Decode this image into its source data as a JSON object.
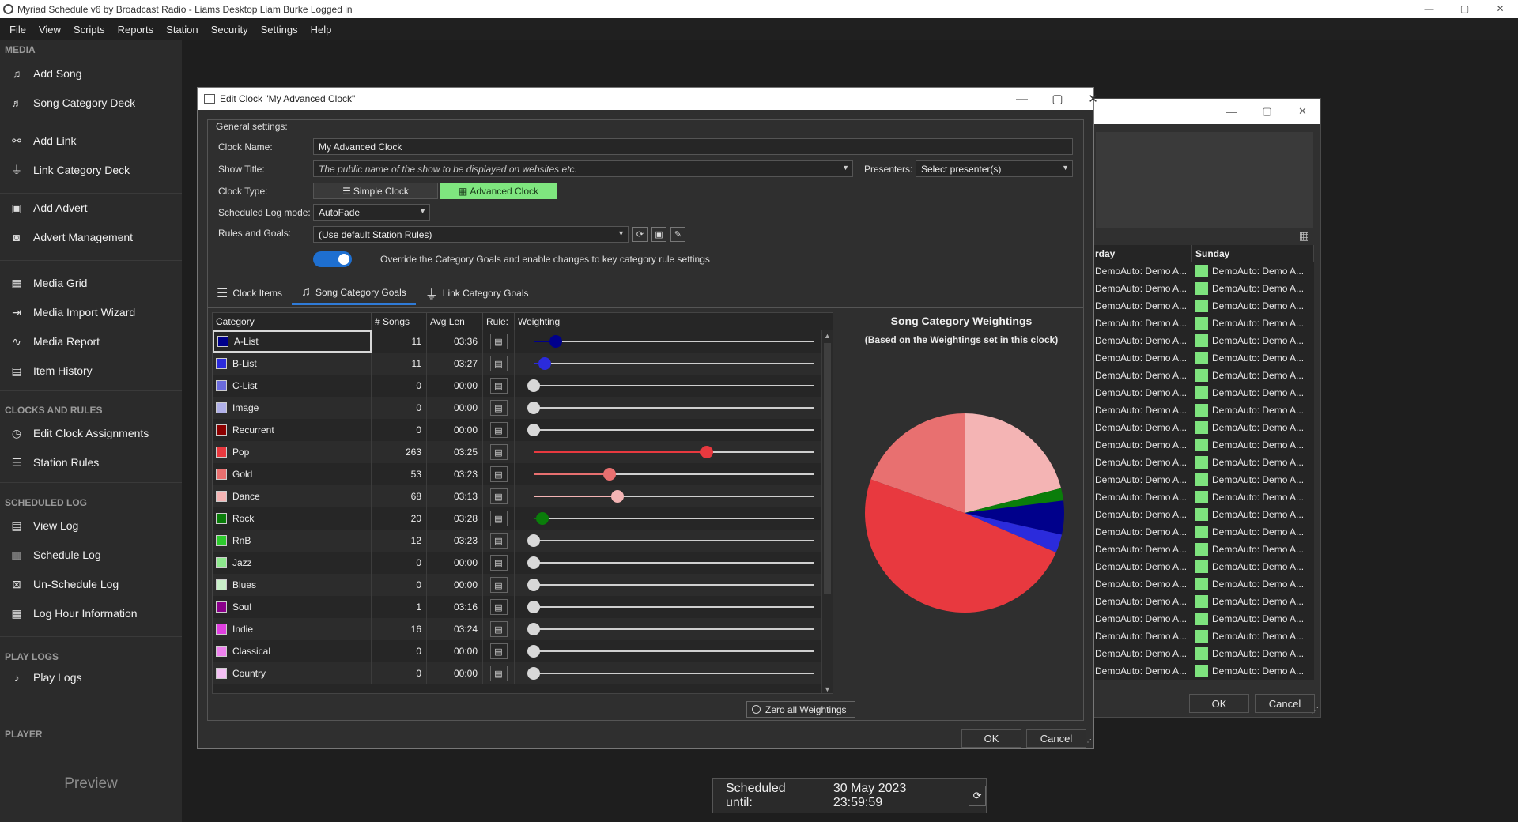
{
  "window": {
    "title": "Myriad Schedule v6 by Broadcast Radio - Liams Desktop Liam Burke Logged in",
    "min": "—",
    "max": "▢",
    "close": "✕"
  },
  "menu": [
    "File",
    "View",
    "Scripts",
    "Reports",
    "Station",
    "Security",
    "Settings",
    "Help"
  ],
  "sidebar": {
    "sections": [
      {
        "label": "MEDIA",
        "items": [
          {
            "label": "Add Song",
            "icon": "add-song-icon"
          },
          {
            "label": "Song Category Deck",
            "icon": "music-note-icon"
          },
          {
            "label": "Add Link",
            "icon": "add-link-icon"
          },
          {
            "label": "Link Category Deck",
            "icon": "antenna-icon"
          },
          {
            "label": "Add Advert",
            "icon": "add-advert-icon"
          },
          {
            "label": "Advert Management",
            "icon": "camera-icon"
          },
          {
            "label": "Media Grid",
            "icon": "grid-icon"
          },
          {
            "label": "Media Import Wizard",
            "icon": "import-icon"
          },
          {
            "label": "Media Report",
            "icon": "waveform-icon"
          },
          {
            "label": "Item History",
            "icon": "history-icon"
          }
        ]
      },
      {
        "label": "CLOCKS AND RULES",
        "items": [
          {
            "label": "Edit Clock Assignments",
            "icon": "clock-icon"
          },
          {
            "label": "Station Rules",
            "icon": "rules-icon"
          }
        ]
      },
      {
        "label": "SCHEDULED LOG",
        "items": [
          {
            "label": "View Log",
            "icon": "log-icon"
          },
          {
            "label": "Schedule Log",
            "icon": "schedule-icon"
          },
          {
            "label": "Un-Schedule Log",
            "icon": "unschedule-icon"
          },
          {
            "label": "Log Hour Information",
            "icon": "table-icon"
          }
        ]
      },
      {
        "label": "PLAY LOGS",
        "items": [
          {
            "label": "Play Logs",
            "icon": "play-logs-icon"
          }
        ]
      },
      {
        "label": "PLAYER",
        "items": []
      }
    ],
    "preview": "Preview"
  },
  "scheduled": {
    "label": "Scheduled until:",
    "value": "30 May 2023 23:59:59"
  },
  "bg_window": {
    "columns": [
      "rday",
      "Sunday"
    ],
    "row_text": "DemoAuto: Demo A...",
    "row_count": 24,
    "ok": "OK",
    "cancel": "Cancel"
  },
  "dialog": {
    "title": "Edit Clock \"My Advanced Clock\"",
    "group_label": "General settings:",
    "clock_name_label": "Clock Name:",
    "clock_name": "My Advanced Clock",
    "show_title_label": "Show Title:",
    "show_title_placeholder": "The public name of the show to be displayed on websites etc.",
    "presenters_label": "Presenters:",
    "presenters_value": "Select presenter(s)",
    "clock_type_label": "Clock Type:",
    "simple_clock": "Simple Clock",
    "advanced_clock": "Advanced Clock",
    "log_mode_label": "Scheduled Log mode:",
    "log_mode": "AutoFade",
    "rules_label": "Rules and Goals:",
    "rules_value": "(Use default Station Rules)",
    "override_text": "Override the Category Goals and enable changes to key category rule settings",
    "override_on": true,
    "tabs": [
      "Clock Items",
      "Song Category Goals",
      "Link Category Goals"
    ],
    "active_tab": "Song Category Goals",
    "columns": [
      "Category",
      "# Songs",
      "Avg Len",
      "Rule:",
      "Weighting"
    ],
    "rows": [
      {
        "name": "A-List",
        "songs": "11",
        "len": "03:36",
        "color": "#00008b",
        "weight": 0.08
      },
      {
        "name": "B-List",
        "songs": "11",
        "len": "03:27",
        "color": "#2b2bdc",
        "weight": 0.04
      },
      {
        "name": "C-List",
        "songs": "0",
        "len": "00:00",
        "color": "#6b6bdc",
        "weight": 0
      },
      {
        "name": "Image",
        "songs": "0",
        "len": "00:00",
        "color": "#b0b0e8",
        "weight": 0
      },
      {
        "name": "Recurrent",
        "songs": "0",
        "len": "00:00",
        "color": "#8b0000",
        "weight": 0
      },
      {
        "name": "Pop",
        "songs": "263",
        "len": "03:25",
        "color": "#e8393f",
        "weight": 0.62
      },
      {
        "name": "Gold",
        "songs": "53",
        "len": "03:23",
        "color": "#e87070",
        "weight": 0.27
      },
      {
        "name": "Dance",
        "songs": "68",
        "len": "03:13",
        "color": "#f4b4b4",
        "weight": 0.3
      },
      {
        "name": "Rock",
        "songs": "20",
        "len": "03:28",
        "color": "#0a7d0a",
        "weight": 0.03
      },
      {
        "name": "RnB",
        "songs": "12",
        "len": "03:23",
        "color": "#2ecb2e",
        "weight": 0
      },
      {
        "name": "Jazz",
        "songs": "0",
        "len": "00:00",
        "color": "#8ee88e",
        "weight": 0
      },
      {
        "name": "Blues",
        "songs": "0",
        "len": "00:00",
        "color": "#c8f0c8",
        "weight": 0
      },
      {
        "name": "Soul",
        "songs": "1",
        "len": "03:16",
        "color": "#8b008b",
        "weight": 0
      },
      {
        "name": "Indie",
        "songs": "16",
        "len": "03:24",
        "color": "#e040e0",
        "weight": 0
      },
      {
        "name": "Classical",
        "songs": "0",
        "len": "00:00",
        "color": "#ee82ee",
        "weight": 0
      },
      {
        "name": "Country",
        "songs": "0",
        "len": "00:00",
        "color": "#f4c0f4",
        "weight": 0
      }
    ],
    "zero_weightings": "Zero all Weightings",
    "ok": "OK",
    "cancel": "Cancel"
  },
  "chart_data": {
    "type": "pie",
    "title": "Song Category Weightings",
    "subtitle": "(Based on the Weightings set in this clock)",
    "slices": [
      {
        "name": "Dance",
        "value": 21,
        "color": "#f4b4b4"
      },
      {
        "name": "Rock",
        "value": 2,
        "color": "#0a7d0a"
      },
      {
        "name": "A-List",
        "value": 5.5,
        "color": "#00008b"
      },
      {
        "name": "B-List",
        "value": 3,
        "color": "#2b2bdc"
      },
      {
        "name": "Pop",
        "value": 49,
        "color": "#e8393f"
      },
      {
        "name": "Gold",
        "value": 19.5,
        "color": "#e87070"
      }
    ]
  }
}
